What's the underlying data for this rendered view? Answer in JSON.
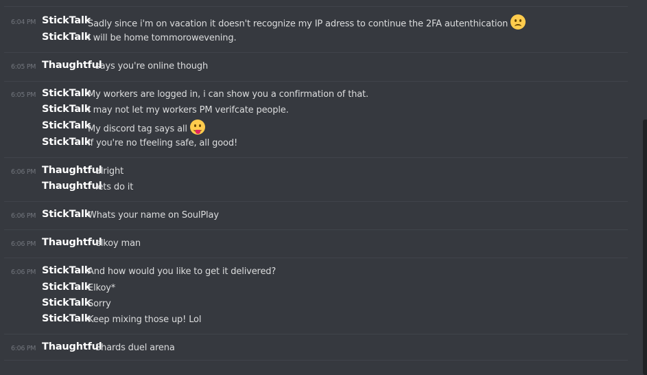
{
  "groups": [
    {
      "timestamp": "6:04 PM",
      "messages": [
        {
          "author": "StickTalk",
          "text": "Sadly since i'm on vacation it doesn't recognize my IP adress to continue the 2FA autenthication",
          "emoji": "frowning-face"
        },
        {
          "author": "StickTalk",
          "text": "I will be home tommorowevening."
        }
      ]
    },
    {
      "timestamp": "6:05 PM",
      "messages": [
        {
          "author": "Thaughtful",
          "text": "says you're online though"
        }
      ]
    },
    {
      "timestamp": "6:05 PM",
      "messages": [
        {
          "author": "StickTalk",
          "text": "My workers are logged in, i can show you a confirmation of that."
        },
        {
          "author": "StickTalk",
          "text": "I may not let my workers PM verifcate people."
        },
        {
          "author": "StickTalk",
          "text": "My discord tag says all",
          "emoji": "tongue-face"
        },
        {
          "author": "StickTalk",
          "text": "If you're no tfeeling safe, all good!"
        }
      ]
    },
    {
      "timestamp": "6:06 PM",
      "messages": [
        {
          "author": "Thaughtful",
          "text": "alright"
        },
        {
          "author": "Thaughtful",
          "text": "lets do it"
        }
      ]
    },
    {
      "timestamp": "6:06 PM",
      "messages": [
        {
          "author": "StickTalk",
          "text": "Whats your name on SoulPlay"
        }
      ]
    },
    {
      "timestamp": "6:06 PM",
      "messages": [
        {
          "author": "Thaughtful",
          "text": "elkoy man"
        }
      ]
    },
    {
      "timestamp": "6:06 PM",
      "messages": [
        {
          "author": "StickTalk",
          "text": "And how would you like to get it delivered?"
        },
        {
          "author": "StickTalk",
          "text": "Elkoy*"
        },
        {
          "author": "StickTalk",
          "text": "Sorry"
        },
        {
          "author": "StickTalk",
          "text": "Keep mixing those up! Lol"
        }
      ]
    },
    {
      "timestamp": "6:06 PM",
      "messages": [
        {
          "author": "Thaughtful",
          "text": "Shards duel arena"
        }
      ]
    }
  ],
  "colors": {
    "background": "#36393f",
    "author": "#ffffff",
    "text": "#dcddde",
    "timestamp": "#72767d",
    "divider": "#40444b"
  }
}
